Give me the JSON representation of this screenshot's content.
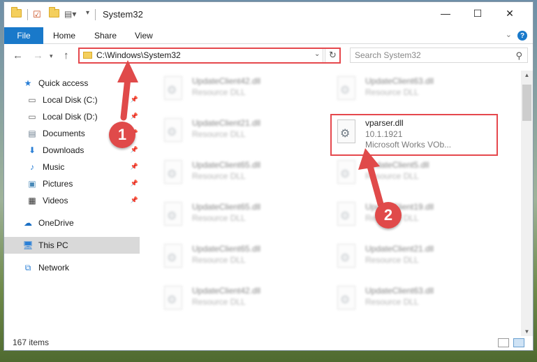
{
  "window": {
    "title": "System32",
    "controls": {
      "minimize": "—",
      "maximize": "☐",
      "close": "✕"
    }
  },
  "ribbon": {
    "tabs": [
      {
        "label": "File"
      },
      {
        "label": "Home"
      },
      {
        "label": "Share"
      },
      {
        "label": "View"
      }
    ],
    "help": "?"
  },
  "address": {
    "path": "C:\\Windows\\System32",
    "search_placeholder": "Search System32"
  },
  "nav": {
    "items": [
      {
        "label": "Quick access",
        "icon": "star-icon"
      },
      {
        "label": "Local Disk (C:)",
        "icon": "drive-icon",
        "pinned": true
      },
      {
        "label": "Local Disk (D:)",
        "icon": "drive-icon",
        "pinned": true
      },
      {
        "label": "Documents",
        "icon": "documents-icon",
        "pinned": true
      },
      {
        "label": "Downloads",
        "icon": "downloads-icon",
        "pinned": true
      },
      {
        "label": "Music",
        "icon": "music-icon",
        "pinned": true
      },
      {
        "label": "Pictures",
        "icon": "pictures-icon",
        "pinned": true
      },
      {
        "label": "Videos",
        "icon": "videos-icon",
        "pinned": true
      },
      {
        "label": "OneDrive",
        "icon": "onedrive-icon"
      },
      {
        "label": "This PC",
        "icon": "pc-icon",
        "selected": true
      },
      {
        "label": "Network",
        "icon": "network-icon"
      }
    ]
  },
  "files": {
    "left_column": [
      {
        "name": "UpdateClient42.dll",
        "desc": "Resource DLL"
      },
      {
        "name": "UpdateClient21.dll",
        "desc": "Resource DLL"
      },
      {
        "name": "UpdateClient65.dll",
        "desc": "Resource DLL"
      },
      {
        "name": "UpdateClient65.dll",
        "desc": "Resource DLL"
      },
      {
        "name": "UpdateClient65.dll",
        "desc": "Resource DLL"
      },
      {
        "name": "UpdateClient42.dll",
        "desc": "Resource DLL"
      }
    ],
    "right_column": [
      {
        "name": "UpdateClient63.dll",
        "desc": "Resource DLL"
      },
      {
        "name": "vparser.dll",
        "version": "10.1.1921",
        "desc": "Microsoft Works VOb..."
      },
      {
        "name": "UpdateClient5.dll",
        "desc": "Resource DLL"
      },
      {
        "name": "UpdateClient19.dll",
        "desc": "Resource DLL"
      },
      {
        "name": "UpdateClient21.dll",
        "desc": "Resource DLL"
      },
      {
        "name": "UpdateClient63.dll",
        "desc": "Resource DLL"
      }
    ]
  },
  "status": {
    "count": "167 items"
  },
  "annotations": {
    "marker1": "1",
    "marker2": "2",
    "color": "#e04a4a"
  }
}
